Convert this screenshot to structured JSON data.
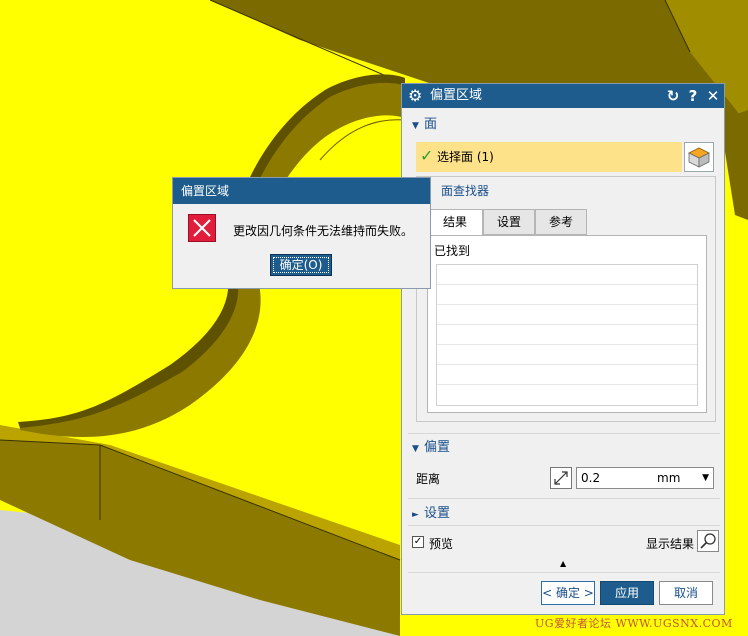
{
  "offset_dialog": {
    "title": "偏置区域",
    "reset_icon": "↻",
    "help_icon": "?",
    "close_icon": "✕",
    "face_group": {
      "label": "面",
      "select_face_label": "选择面 (1)",
      "finder_title": "面查找器",
      "tabs": [
        "结果",
        "设置",
        "参考"
      ],
      "found_label": "已找到"
    },
    "offset_group": {
      "label": "偏置",
      "distance_label": "距离",
      "distance_value": "0.2",
      "distance_unit": "mm"
    },
    "settings_group": {
      "label": "设置"
    },
    "preview": {
      "label": "预览",
      "checked": true,
      "show_result_label": "显示结果"
    },
    "buttons": {
      "ok": "< 确定 >",
      "apply": "应用",
      "cancel": "取消"
    }
  },
  "error_dialog": {
    "title": "偏置区域",
    "message": "更改因几何条件无法维持而失败。",
    "ok": "确定(O)"
  },
  "watermark": "UG爱好者论坛 WWW.UGSNX.COM",
  "colors": {
    "model_face": "#ffff00",
    "model_side": "#7a6a00",
    "titlebar": "#1d5c8c",
    "selection_highlight": "#fde28a",
    "error_red": "#e11d3c"
  }
}
